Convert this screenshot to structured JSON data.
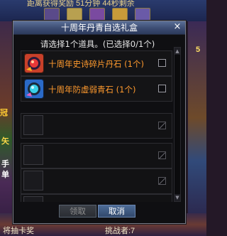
{
  "background": {
    "top_text": "距离获得奖励 51分钟 44秒剩余",
    "side_texts": [
      "冠",
      "矢",
      "手",
      "单",
      "5"
    ],
    "bottom_left": "将抽卡奖",
    "bottom_right": "挑战者:7"
  },
  "dialog": {
    "title": "十周年丹青自选礼盒",
    "close_label": "×",
    "prompt": "请选择1个道具。(已选择0/1个)",
    "items": [
      {
        "name": "十周年史诗碎片丹石 (1个)",
        "icon": "red-stone-icon",
        "checked": false
      },
      {
        "name": "十周年防虚弱青石 (1个)",
        "icon": "blue-stone-icon",
        "checked": false
      }
    ],
    "empty_slots": 4,
    "buttons": {
      "confirm_label": "领取",
      "cancel_label": "取消"
    },
    "colors": {
      "item_text": "#ff9a2e",
      "title_bar": "#3c4c72"
    }
  }
}
